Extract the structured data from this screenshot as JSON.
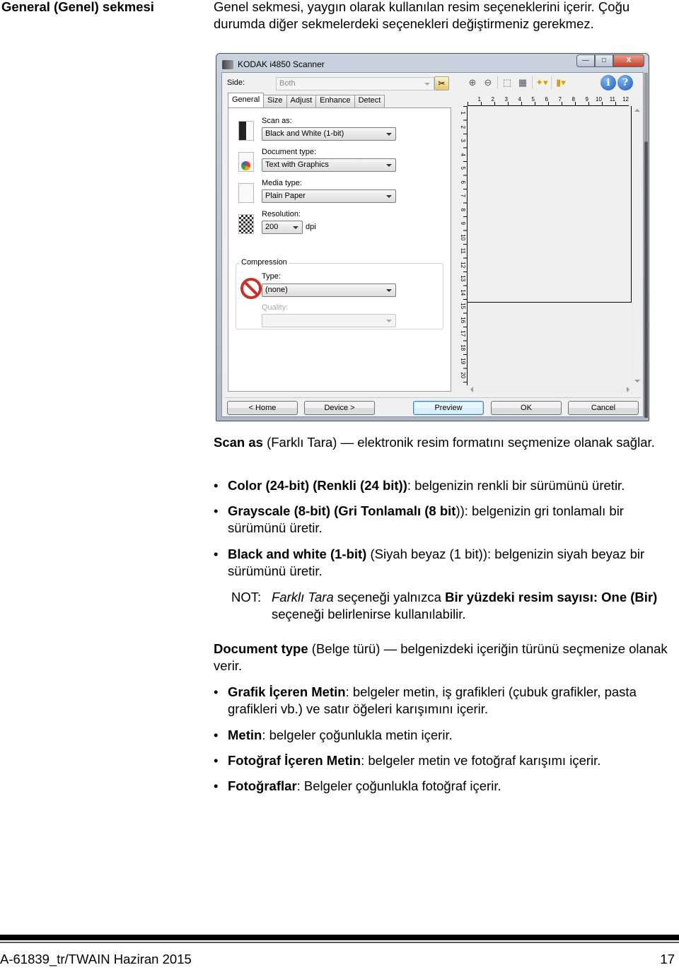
{
  "section": {
    "heading": "General (Genel) sekmesi",
    "intro": "Genel sekmesi, yaygın olarak kullanılan resim seçeneklerini içerir. Çoğu durumda diğer sekmelerdeki seçenekleri değiştirmeniz gerekmez."
  },
  "window": {
    "title": "KODAK i4850 Scanner",
    "controls": {
      "minimize": "—",
      "maximize": "□",
      "close": "X"
    },
    "side": {
      "label": "Side:",
      "value": "Both"
    },
    "tabs": [
      "General",
      "Size",
      "Adjust",
      "Enhance",
      "Detect"
    ],
    "active_tab": "General",
    "fields": {
      "scan_as": {
        "label": "Scan as:",
        "value": "Black and White (1-bit)"
      },
      "document_type": {
        "label": "Document type:",
        "value": "Text with Graphics"
      },
      "media_type": {
        "label": "Media type:",
        "value": "Plain Paper"
      },
      "resolution": {
        "label": "Resolution:",
        "value": "200",
        "unit": "dpi"
      },
      "compression": {
        "legend": "Compression",
        "type_label": "Type:",
        "type_value": "(none)",
        "quality_label": "Quality:",
        "quality_value": ""
      }
    },
    "toolbar_icons": [
      "zoom-in-icon",
      "zoom-out-icon",
      "crop-icon",
      "fit-icon",
      "bookmark-dropdown-icon",
      "ruler-dropdown-icon"
    ],
    "ruler_top": [
      "1",
      "2",
      "3",
      "4",
      "5",
      "6",
      "7",
      "8",
      "9",
      "10",
      "11",
      "12"
    ],
    "ruler_left": [
      "1",
      "2",
      "3",
      "4",
      "5",
      "6",
      "7",
      "8",
      "9",
      "10",
      "11",
      "12",
      "13",
      "14",
      "15",
      "16",
      "17",
      "18",
      "19",
      "20"
    ],
    "help": {
      "info": "i",
      "question": "?"
    },
    "buttons": {
      "home": "< Home",
      "device": "Device >",
      "preview": "Preview",
      "ok": "OK",
      "cancel": "Cancel"
    }
  },
  "content": {
    "scan_as_para": {
      "bold": "Scan as",
      "rest": " (Farklı Tara) — elektronik resim formatını seçmenize olanak sağlar."
    },
    "scan_as_items": [
      {
        "bold": "Color (24-bit) (Renkli (24 bit))",
        "rest": ": belgenizin renkli bir sürümünü üretir."
      },
      {
        "bold": "Grayscale (8-bit) (Gri Tonlamalı (8 bit",
        "rest": ")): belgenizin gri tonlamalı bir sürümünü üretir."
      },
      {
        "bold": "Black and white (1-bit)",
        "rest": " (Siyah beyaz (1 bit)): belgenizin siyah beyaz bir sürümünü üretir."
      }
    ],
    "note": {
      "label": "NOT:",
      "italic": "Farklı Tara",
      "mid": " seçeneği yalnızca ",
      "bold": "Bir yüzdeki resim sayısı: One (Bir)",
      "end": " seçeneği belirlenirse kullanılabilir."
    },
    "doc_type_para": {
      "bold": "Document type",
      "rest": " (Belge türü) — belgenizdeki içeriğin türünü seçmenize olanak verir."
    },
    "doc_type_items": [
      {
        "bold": "Grafik İçeren Metin",
        "rest": ": belgeler metin, iş grafikleri (çubuk grafikler, pasta grafikleri vb.) ve satır öğeleri karışımını içerir."
      },
      {
        "bold": "Metin",
        "rest": ": belgeler çoğunlukla metin içerir."
      },
      {
        "bold": "Fotoğraf İçeren Metin",
        "rest": ": belgeler metin ve fotoğraf karışımı içerir."
      },
      {
        "bold": "Fotoğraflar",
        "rest": ": Belgeler çoğunlukla fotoğraf içerir."
      }
    ],
    "bullet_char": "•"
  },
  "footer": {
    "doc_id": "A-61839_tr/TWAIN  Haziran 2015",
    "page_number": "17"
  }
}
